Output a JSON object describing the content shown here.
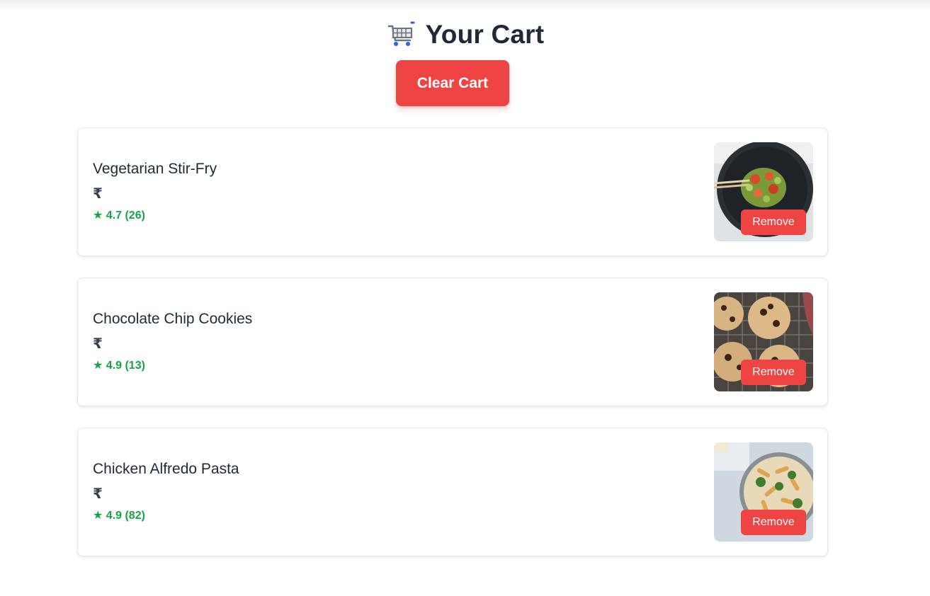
{
  "header": {
    "title": "Your Cart",
    "icon": "shopping-cart-icon"
  },
  "clear_button": {
    "label": "Clear Cart"
  },
  "colors": {
    "accent": "#ef4444",
    "rating": "#16a34a",
    "text": "#1f2937"
  },
  "cart_items": [
    {
      "name": "Vegetarian Stir-Fry",
      "price": "₹",
      "rating": "★ 4.7 (26)",
      "image": "stir-fry-photo",
      "remove_label": "Remove"
    },
    {
      "name": "Chocolate Chip Cookies",
      "price": "₹",
      "rating": "★ 4.9 (13)",
      "image": "cookies-photo",
      "remove_label": "Remove"
    },
    {
      "name": "Chicken Alfredo Pasta",
      "price": "₹",
      "rating": "★ 4.9 (82)",
      "image": "pasta-photo",
      "remove_label": "Remove"
    }
  ]
}
